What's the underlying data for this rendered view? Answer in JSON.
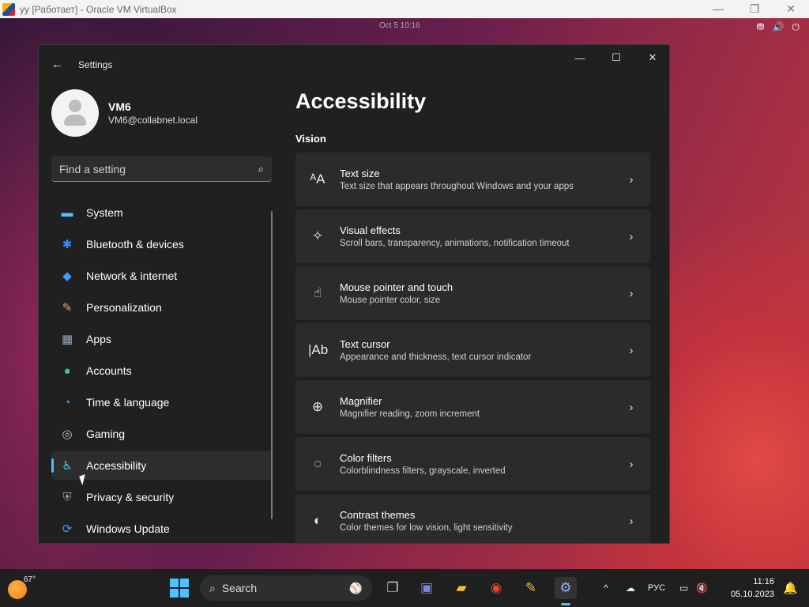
{
  "host": {
    "title": "yy [Работает] - Oracle VM VirtualBox",
    "controls": [
      "—",
      "❐",
      "✕"
    ]
  },
  "guest": {
    "clock": "Oct 5 10:16",
    "tray": [
      "⛃",
      "🔊",
      "⏻"
    ]
  },
  "settings": {
    "window_title": "Settings",
    "back_icon": "←",
    "controls": {
      "minimize": "—",
      "maximize": "☐",
      "close": "✕"
    },
    "profile": {
      "name": "VM6",
      "email": "VM6@collabnet.local"
    },
    "search": {
      "placeholder": "Find a setting",
      "icon": "⌕"
    },
    "nav": [
      {
        "label": "System",
        "icon": "▬",
        "color": "#4cc2ff",
        "active": false
      },
      {
        "label": "Bluetooth & devices",
        "icon": "✱",
        "color": "#2f8cff",
        "active": false
      },
      {
        "label": "Network & internet",
        "icon": "◆",
        "color": "#3aa0ff",
        "active": false
      },
      {
        "label": "Personalization",
        "icon": "✎",
        "color": "#e8a25a",
        "active": false
      },
      {
        "label": "Apps",
        "icon": "▦",
        "color": "#9aa6b8",
        "active": false
      },
      {
        "label": "Accounts",
        "icon": "●",
        "color": "#35c3a2",
        "active": false
      },
      {
        "label": "Time & language",
        "icon": "◔",
        "color": "#3aa0ff",
        "active": false
      },
      {
        "label": "Gaming",
        "icon": "◎",
        "color": "#c0c0c0",
        "active": false
      },
      {
        "label": "Accessibility",
        "icon": "♿",
        "color": "#4cc2ff",
        "active": true
      },
      {
        "label": "Privacy & security",
        "icon": "⛨",
        "color": "#9a9a9a",
        "active": false
      },
      {
        "label": "Windows Update",
        "icon": "⟳",
        "color": "#3aa0ff",
        "active": false
      }
    ],
    "page_title": "Accessibility",
    "section": "Vision",
    "cards": [
      {
        "title": "Text size",
        "sub": "Text size that appears throughout Windows and your apps",
        "icon": "ᴬA"
      },
      {
        "title": "Visual effects",
        "sub": "Scroll bars, transparency, animations, notification timeout",
        "icon": "✧"
      },
      {
        "title": "Mouse pointer and touch",
        "sub": "Mouse pointer color, size",
        "icon": "☝"
      },
      {
        "title": "Text cursor",
        "sub": "Appearance and thickness, text cursor indicator",
        "icon": "|Ab"
      },
      {
        "title": "Magnifier",
        "sub": "Magnifier reading, zoom increment",
        "icon": "⊕"
      },
      {
        "title": "Color filters",
        "sub": "Colorblindness filters, grayscale, inverted",
        "icon": "◌"
      },
      {
        "title": "Contrast themes",
        "sub": "Color themes for low vision, light sensitivity",
        "icon": "◐"
      }
    ],
    "chevron": "›"
  },
  "taskbar": {
    "weather_temp": "67°",
    "search_label": "Search",
    "search_icon": "⌕",
    "search_deco": "⚾",
    "apps": [
      {
        "name": "task-view",
        "glyph": "❐",
        "color": "#c8c8c8"
      },
      {
        "name": "teams",
        "glyph": "▣",
        "color": "#7b83eb"
      },
      {
        "name": "file-explorer",
        "glyph": "▰",
        "color": "#f2c230"
      },
      {
        "name": "chrome",
        "glyph": "◉",
        "color": "#e34133"
      },
      {
        "name": "app-gdb",
        "glyph": "✎",
        "color": "#f2c230"
      },
      {
        "name": "settings",
        "glyph": "⚙",
        "color": "#8ab4f8"
      }
    ],
    "tray": {
      "chevron": "^",
      "onedrive": "☁",
      "lang": "РУС",
      "net": "▭",
      "vol": "🔇"
    },
    "time": "11:16",
    "date": "05.10.2023",
    "bell": "🔔"
  }
}
